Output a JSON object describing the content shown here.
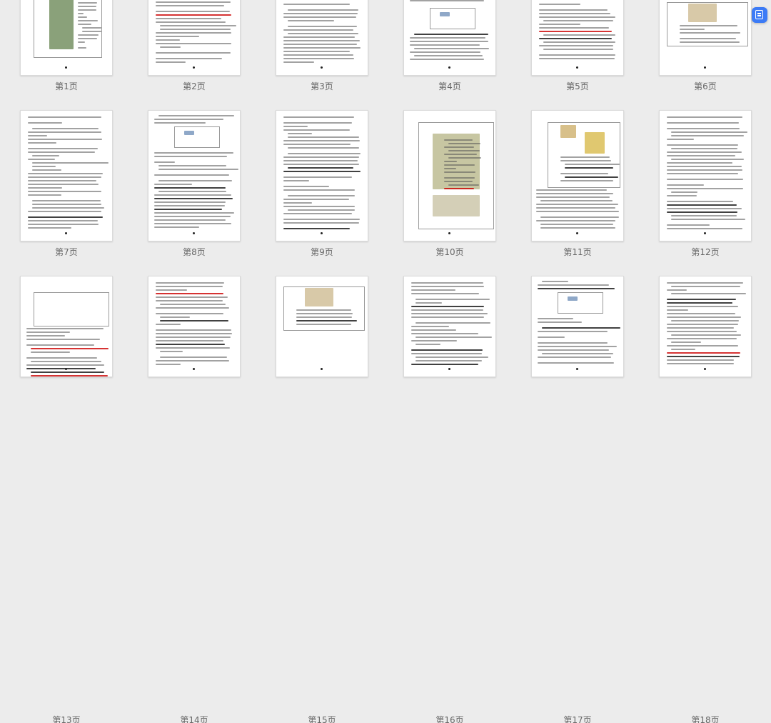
{
  "viewer": {
    "page_labels": [
      "第1页",
      "第2页",
      "第3页",
      "第4页",
      "第5页",
      "第6页",
      "第7页",
      "第8页",
      "第9页",
      "第10页",
      "第11页",
      "第12页",
      "第13页",
      "第14页",
      "第15页",
      "第16页",
      "第17页",
      "第18页"
    ]
  },
  "floating_button": {
    "icon": "document-convert-icon",
    "color": "#3c7bf6"
  }
}
